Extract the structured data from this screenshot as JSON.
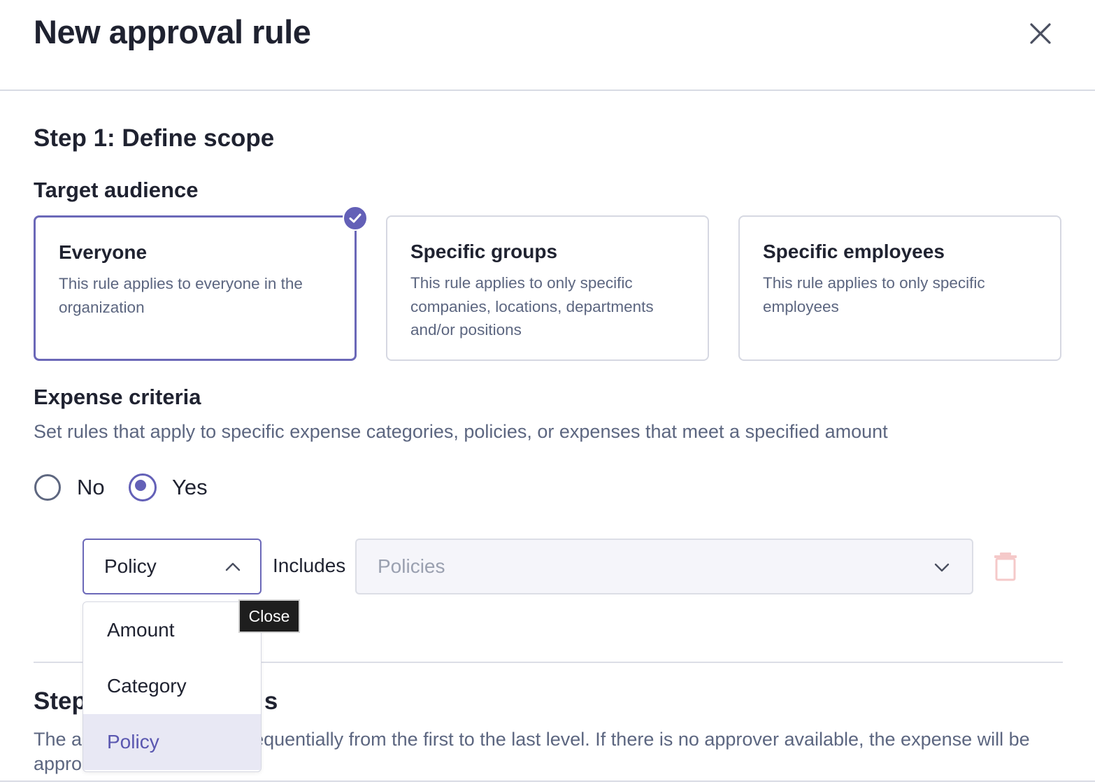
{
  "modal": {
    "title": "New approval rule"
  },
  "step1": {
    "title": "Step 1: Define scope",
    "target_audience": {
      "heading": "Target audience",
      "options": [
        {
          "title": "Everyone",
          "description": "This rule applies to everyone in the organization",
          "selected": true
        },
        {
          "title": "Specific groups",
          "description": "This rule applies to only specific companies, locations, departments and/or positions",
          "selected": false
        },
        {
          "title": "Specific employees",
          "description": "This rule applies to only specific employees",
          "selected": false
        }
      ]
    },
    "expense_criteria": {
      "heading": "Expense criteria",
      "description": "Set rules that apply to specific expense categories, policies, or expenses that meet a specified amount",
      "radio_no": "No",
      "radio_yes": "Yes",
      "selected": "Yes",
      "criterion": {
        "field_value": "Policy",
        "operator": "Includes",
        "values_placeholder": "Policies"
      },
      "field_menu": {
        "options": [
          "Amount",
          "Category",
          "Policy"
        ],
        "active": "Policy"
      },
      "tooltip": "Close"
    }
  },
  "step2": {
    "title_visible_left": "Step",
    "title_visible_right": "s",
    "description_line1_left": "The ap",
    "description_line1_right": "equentially from the first to the last level. If there is no approver available, the expense will be",
    "description_line2_left": "appro"
  },
  "colors": {
    "accent": "#6360b7",
    "text_primary": "#1f2230",
    "text_secondary": "#5c6680",
    "delete_icon": "#f5c9c9"
  },
  "icons": {
    "close": "close-icon",
    "check": "check-icon",
    "chevron_up": "chevron-up-icon",
    "chevron_down": "chevron-down-icon",
    "delete": "trash-icon"
  }
}
